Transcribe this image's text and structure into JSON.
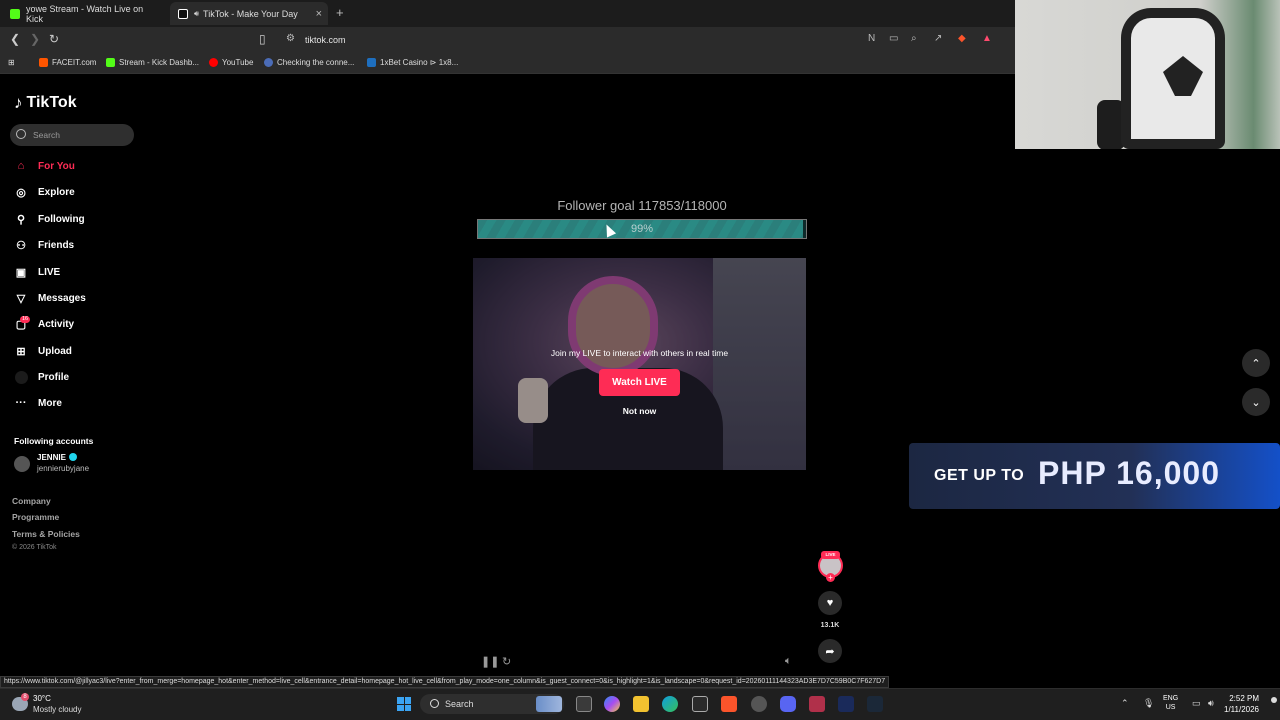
{
  "browser": {
    "tabs": [
      {
        "title": "yowe Stream - Watch Live on Kick",
        "icon": "kick-icon",
        "color": "#53fc18"
      },
      {
        "title": "TikTok - Make Your Day",
        "icon": "tiktok-icon",
        "color": "#ffffff"
      }
    ],
    "address": "tiktok.com",
    "bookmarks": [
      {
        "label": "FACEIT.com",
        "color": "#ff5500"
      },
      {
        "label": "Stream - Kick Dashb...",
        "color": "#53fc18"
      },
      {
        "label": "YouTube",
        "color": "#ff0000"
      },
      {
        "label": "Checking the conne...",
        "color": "#4b6cb7"
      },
      {
        "label": "1xBet Casino ⊳ 1x8...",
        "color": "#1e6fbf"
      }
    ],
    "status_url": "https://www.tiktok.com/@jillyac3/live?enter_from_merge=homepage_hot&enter_method=live_cell&entrance_detail=homepage_hot_live_cell&from_play_mode=one_column&is_guest_connect=0&is_highlight=1&is_landscape=0&request_id=20260111144323AD3E7D7C59B0C7F627D7"
  },
  "tiktok": {
    "logo": "TikTok",
    "search_placeholder": "Search",
    "nav": [
      {
        "label": "For You",
        "icon": "home-icon",
        "active": true
      },
      {
        "label": "Explore",
        "icon": "compass-icon"
      },
      {
        "label": "Following",
        "icon": "following-icon"
      },
      {
        "label": "Friends",
        "icon": "friends-icon"
      },
      {
        "label": "LIVE",
        "icon": "live-tv-icon"
      },
      {
        "label": "Messages",
        "icon": "messages-icon"
      },
      {
        "label": "Activity",
        "icon": "activity-icon",
        "badge": "16"
      },
      {
        "label": "Upload",
        "icon": "upload-icon"
      },
      {
        "label": "Profile",
        "icon": "profile-avatar"
      },
      {
        "label": "More",
        "icon": "more-icon"
      }
    ],
    "following_accounts_title": "Following accounts",
    "account": {
      "name": "JENNIE",
      "handle": "jennierubyjane"
    },
    "footer": [
      "Company",
      "Programme",
      "Terms & Policies"
    ],
    "copyright": "© 2026 TikTok"
  },
  "live": {
    "goal_text": "Follower goal  117853/118000",
    "goal_fraction": 0.99,
    "goal_percent_label": "99%",
    "prompt": "Join my LIVE to interact with others in real time",
    "watch_button": "Watch LIVE",
    "not_now": "Not now",
    "live_badge": "LIVE",
    "like_count": "13.1K"
  },
  "ad": {
    "prefix": "GET UP TO",
    "amount": "PHP 16,000"
  },
  "taskbar": {
    "weather_temp": "30°C",
    "weather_desc": "Mostly cloudy",
    "weather_badge": "8",
    "search_label": "Search",
    "lang_top": "ENG",
    "lang_bottom": "US",
    "time": "2:52 PM",
    "date": "1/11/2026"
  }
}
